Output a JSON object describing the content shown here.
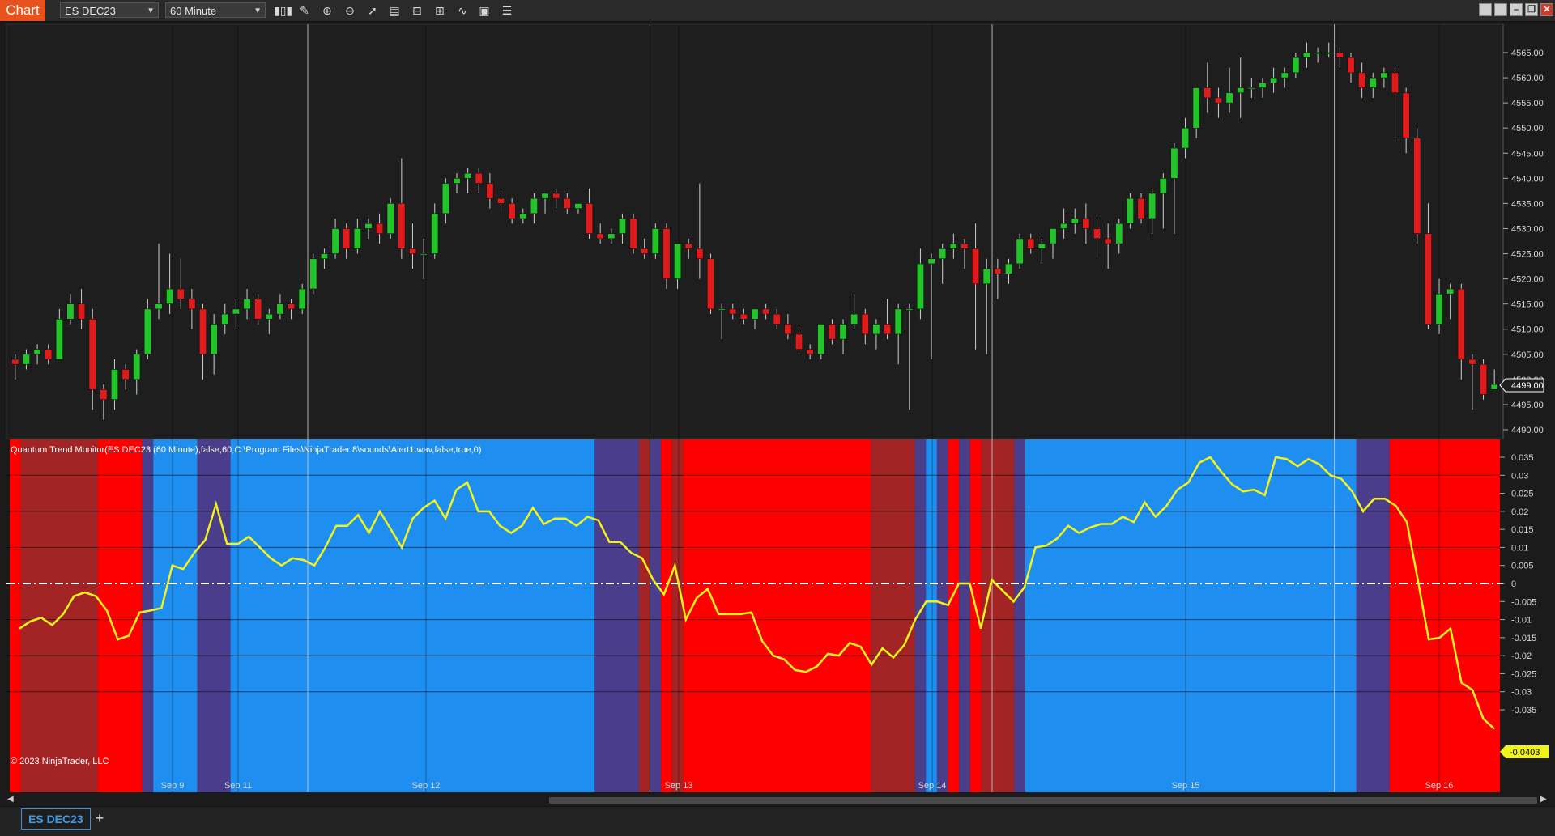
{
  "toolbar": {
    "chart_label": "Chart",
    "instrument": "ES DEC23",
    "interval": "60 Minute",
    "tools": [
      "bar-chart-icon",
      "pencil-icon",
      "zoom-in-icon",
      "zoom-out-icon",
      "pointer-icon",
      "data-box-icon",
      "properties-icon",
      "templates-icon",
      "indicators-icon",
      "strategies-icon",
      "list-icon"
    ],
    "window_buttons": [
      "restore-icon",
      "maximize-icon",
      "minimize-icon",
      "popout-icon",
      "close-icon"
    ]
  },
  "indicator_label": "Quantum Trend Monitor(ES DEC23 (60 Minute),false,60,C:\\Program Files\\NinjaTrader 8\\sounds\\Alert1.wav,false,true,0)",
  "copyright": "© 2023 NinjaTrader, LLC",
  "price_axis": {
    "ticks": [
      "4565.00",
      "4560.00",
      "4555.00",
      "4550.00",
      "4545.00",
      "4540.00",
      "4535.00",
      "4530.00",
      "4525.00",
      "4520.00",
      "4515.00",
      "4510.00",
      "4505.00",
      "4500.00",
      "4495.00",
      "4490.00"
    ],
    "current_price": "4499.00"
  },
  "indicator_axis": {
    "ticks": [
      "0.035",
      "0.03",
      "0.025",
      "0.02",
      "0.015",
      "0.01",
      "0.005",
      "0",
      "-0.005",
      "-0.01",
      "-0.015",
      "-0.02",
      "-0.025",
      "-0.03",
      "-0.035"
    ],
    "current_value": "-0.0403"
  },
  "time_axis": [
    "Sep 9",
    "Sep 11",
    "Sep 12",
    "Sep 13",
    "Sep 14",
    "Sep 15",
    "Sep 16"
  ],
  "status": {
    "instrument_tab": "ES DEC23",
    "add_tab": "+"
  },
  "colors": {
    "up_candle": "#22c42a",
    "down_candle": "#e11b1b",
    "trend_line": "#f2f21c",
    "bull_zone": "#1e8ff0",
    "bear_zone": "#ff0000",
    "bull_fade": "#4a3e8c",
    "bear_fade": "#a32424"
  },
  "chart_data": [
    {
      "type": "candlestick",
      "title": "ES DEC23 60 Minute",
      "ylim": [
        4488,
        4567
      ],
      "ohlc": [
        [
          4504,
          4505,
          4500,
          4503
        ],
        [
          4503,
          4506,
          4502,
          4505
        ],
        [
          4505,
          4507,
          4503,
          4506
        ],
        [
          4506,
          4507,
          4503,
          4504
        ],
        [
          4504,
          4514,
          4504,
          4512
        ],
        [
          4512,
          4517,
          4511,
          4515
        ],
        [
          4515,
          4518,
          4510,
          4512
        ],
        [
          4512,
          4514,
          4494,
          4498
        ],
        [
          4498,
          4499,
          4492,
          4496
        ],
        [
          4496,
          4504,
          4494,
          4502
        ],
        [
          4502,
          4503,
          4498,
          4500
        ],
        [
          4500,
          4506,
          4497,
          4505
        ],
        [
          4505,
          4516,
          4504,
          4514
        ],
        [
          4514,
          4527,
          4512,
          4515
        ],
        [
          4515,
          4525,
          4513,
          4518
        ],
        [
          4518,
          4524,
          4514,
          4516
        ],
        [
          4516,
          4518,
          4510,
          4514
        ],
        [
          4514,
          4515,
          4500,
          4505
        ],
        [
          4505,
          4513,
          4501,
          4511
        ],
        [
          4511,
          4515,
          4509,
          4513
        ],
        [
          4513,
          4516,
          4510,
          4514
        ],
        [
          4514,
          4518,
          4512,
          4516
        ],
        [
          4516,
          4517,
          4511,
          4512
        ],
        [
          4512,
          4514,
          4509,
          4513
        ],
        [
          4513,
          4517,
          4512,
          4515
        ],
        [
          4515,
          4516,
          4512,
          4514
        ],
        [
          4514,
          4519,
          4513,
          4518
        ],
        [
          4518,
          4525,
          4517,
          4524
        ],
        [
          4524,
          4526,
          4522,
          4525
        ],
        [
          4525,
          4532,
          4524,
          4530
        ],
        [
          4530,
          4531,
          4524,
          4526
        ],
        [
          4526,
          4532,
          4525,
          4530
        ],
        [
          4530,
          4532,
          4528,
          4531
        ],
        [
          4531,
          4533,
          4527,
          4529
        ],
        [
          4529,
          4536,
          4528,
          4535
        ],
        [
          4535,
          4544,
          4524,
          4526
        ],
        [
          4526,
          4531,
          4522,
          4525
        ],
        [
          4525,
          4528,
          4520,
          4525
        ],
        [
          4525,
          4535,
          4524,
          4533
        ],
        [
          4533,
          4540,
          4531,
          4539
        ],
        [
          4539,
          4541,
          4537,
          4540
        ],
        [
          4540,
          4542,
          4537,
          4541
        ],
        [
          4541,
          4542,
          4537,
          4539
        ],
        [
          4539,
          4541,
          4534,
          4536
        ],
        [
          4536,
          4537,
          4533,
          4535
        ],
        [
          4535,
          4536,
          4531,
          4532
        ],
        [
          4532,
          4534,
          4531,
          4533
        ],
        [
          4533,
          4537,
          4531,
          4536
        ],
        [
          4536,
          4537,
          4533,
          4537
        ],
        [
          4537,
          4538,
          4534,
          4536
        ],
        [
          4536,
          4537,
          4533,
          4534
        ],
        [
          4534,
          4535,
          4533,
          4535
        ],
        [
          4535,
          4538,
          4528,
          4529
        ],
        [
          4529,
          4531,
          4527,
          4528
        ],
        [
          4528,
          4530,
          4527,
          4529
        ],
        [
          4529,
          4533,
          4527,
          4532
        ],
        [
          4532,
          4533,
          4525,
          4526
        ],
        [
          4526,
          4528,
          4524,
          4525
        ],
        [
          4525,
          4531,
          4524,
          4530
        ],
        [
          4530,
          4531,
          4518,
          4520
        ],
        [
          4520,
          4525,
          4518,
          4527
        ],
        [
          4527,
          4528,
          4524,
          4526
        ],
        [
          4526,
          4539,
          4520,
          4524
        ],
        [
          4524,
          4525,
          4513,
          4514
        ],
        [
          4514,
          4515,
          4508,
          4514
        ],
        [
          4514,
          4515,
          4512,
          4513
        ],
        [
          4513,
          4514,
          4511,
          4512
        ],
        [
          4512,
          4514,
          4510,
          4514
        ],
        [
          4514,
          4515,
          4512,
          4513
        ],
        [
          4513,
          4514,
          4510,
          4511
        ],
        [
          4511,
          4513,
          4508,
          4509
        ],
        [
          4509,
          4510,
          4505,
          4506
        ],
        [
          4506,
          4507,
          4504,
          4505
        ],
        [
          4505,
          4511,
          4504,
          4511
        ],
        [
          4511,
          4512,
          4507,
          4508
        ],
        [
          4508,
          4512,
          4505,
          4511
        ],
        [
          4511,
          4517,
          4510,
          4513
        ],
        [
          4513,
          4514,
          4507,
          4509
        ],
        [
          4509,
          4512,
          4506,
          4511
        ],
        [
          4511,
          4516,
          4508,
          4509
        ],
        [
          4509,
          4515,
          4503,
          4514
        ],
        [
          4514,
          4515,
          4494,
          4514
        ],
        [
          4514,
          4526,
          4512,
          4523
        ],
        [
          4523,
          4525,
          4504,
          4524
        ],
        [
          4524,
          4527,
          4519,
          4526
        ],
        [
          4526,
          4529,
          4524,
          4527
        ],
        [
          4527,
          4528,
          4522,
          4526
        ],
        [
          4526,
          4531,
          4506,
          4519
        ],
        [
          4519,
          4524,
          4505,
          4522
        ],
        [
          4522,
          4524,
          4516,
          4521
        ],
        [
          4521,
          4524,
          4519,
          4523
        ],
        [
          4523,
          4529,
          4522,
          4528
        ],
        [
          4528,
          4529,
          4525,
          4526
        ],
        [
          4526,
          4528,
          4523,
          4527
        ],
        [
          4527,
          4529,
          4524,
          4530
        ],
        [
          4530,
          4534,
          4528,
          4531
        ],
        [
          4531,
          4534,
          4529,
          4532
        ],
        [
          4532,
          4535,
          4527,
          4530
        ],
        [
          4530,
          4532,
          4524,
          4528
        ],
        [
          4528,
          4531,
          4522,
          4527
        ],
        [
          4527,
          4532,
          4525,
          4531
        ],
        [
          4531,
          4537,
          4530,
          4536
        ],
        [
          4536,
          4537,
          4531,
          4532
        ],
        [
          4532,
          4538,
          4529,
          4537
        ],
        [
          4537,
          4541,
          4530,
          4540
        ],
        [
          4540,
          4547,
          4529,
          4546
        ],
        [
          4546,
          4552,
          4544,
          4550
        ],
        [
          4550,
          4557,
          4548,
          4558
        ],
        [
          4558,
          4563,
          4553,
          4556
        ],
        [
          4556,
          4558,
          4552,
          4555
        ],
        [
          4555,
          4562,
          4553,
          4557
        ],
        [
          4557,
          4564,
          4552,
          4558
        ],
        [
          4558,
          4560,
          4556,
          4558
        ],
        [
          4558,
          4560,
          4556,
          4559
        ],
        [
          4559,
          4562,
          4557,
          4560
        ],
        [
          4560,
          4562,
          4558,
          4561
        ],
        [
          4561,
          4565,
          4560,
          4564
        ],
        [
          4564,
          4567,
          4562,
          4565
        ],
        [
          4565,
          4566,
          4563,
          4565
        ],
        [
          4565,
          4567,
          4564,
          4565
        ],
        [
          4565,
          4566,
          4562,
          4564
        ],
        [
          4564,
          4565,
          4559,
          4561
        ],
        [
          4561,
          4563,
          4556,
          4558
        ],
        [
          4558,
          4561,
          4556,
          4560
        ],
        [
          4560,
          4562,
          4558,
          4561
        ],
        [
          4561,
          4562,
          4548,
          4557
        ],
        [
          4557,
          4558,
          4545,
          4548
        ],
        [
          4548,
          4550,
          4527,
          4529
        ],
        [
          4529,
          4535,
          4510,
          4511
        ],
        [
          4511,
          4520,
          4509,
          4517
        ],
        [
          4517,
          4519,
          4512,
          4518
        ],
        [
          4518,
          4519,
          4500,
          4504
        ],
        [
          4504,
          4505,
          4494,
          4503
        ],
        [
          4503,
          4504,
          4496,
          4497
        ],
        [
          4498,
          4502,
          4498,
          4499
        ]
      ]
    },
    {
      "type": "line",
      "title": "Quantum Trend Monitor",
      "ylim": [
        -0.042,
        0.037
      ],
      "values": [
        -0.0125,
        -0.0105,
        -0.0095,
        -0.0115,
        -0.0085,
        -0.0035,
        -0.0025,
        -0.0035,
        -0.0075,
        -0.0155,
        -0.0145,
        -0.008,
        -0.0075,
        -0.0068,
        0.005,
        0.004,
        0.0085,
        0.012,
        0.022,
        0.011,
        0.011,
        0.013,
        0.01,
        0.007,
        0.005,
        0.007,
        0.0065,
        0.005,
        0.01,
        0.016,
        0.016,
        0.019,
        0.014,
        0.02,
        0.015,
        0.01,
        0.018,
        0.021,
        0.023,
        0.018,
        0.026,
        0.028,
        0.02,
        0.02,
        0.016,
        0.014,
        0.016,
        0.021,
        0.0165,
        0.018,
        0.018,
        0.016,
        0.0185,
        0.0175,
        0.0115,
        0.0115,
        0.0085,
        0.007,
        0.001,
        -0.003,
        0.005,
        -0.01,
        -0.004,
        -0.0015,
        -0.0085,
        -0.0085,
        -0.0085,
        -0.008,
        -0.016,
        -0.02,
        -0.021,
        -0.024,
        -0.0245,
        -0.023,
        -0.0195,
        -0.02,
        -0.0165,
        -0.0175,
        -0.0225,
        -0.018,
        -0.0205,
        -0.017,
        -0.01,
        -0.005,
        -0.005,
        -0.006,
        0.0,
        0.0,
        -0.0125,
        0.001,
        -0.002,
        -0.005,
        -0.001,
        0.01,
        0.0105,
        0.0125,
        0.016,
        0.014,
        0.0155,
        0.0165,
        0.0165,
        0.0185,
        0.017,
        0.0225,
        0.0185,
        0.0215,
        0.026,
        0.028,
        0.0335,
        0.035,
        0.031,
        0.0275,
        0.0255,
        0.026,
        0.0245,
        0.035,
        0.0345,
        0.0325,
        0.0345,
        0.033,
        0.03,
        0.029,
        0.0255,
        0.02,
        0.0235,
        0.0235,
        0.0215,
        0.017,
        0.001,
        -0.0155,
        -0.015,
        -0.0125,
        -0.0275,
        -0.0295,
        -0.0375,
        -0.0403
      ]
    }
  ]
}
